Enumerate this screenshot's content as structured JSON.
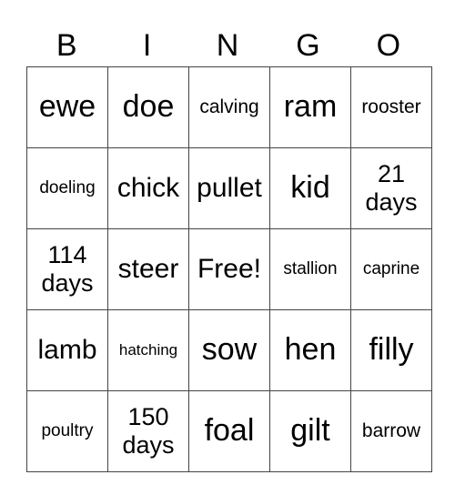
{
  "header": [
    "B",
    "I",
    "N",
    "G",
    "O"
  ],
  "cells": [
    [
      "ewe",
      "doe",
      "calving",
      "ram",
      "rooster"
    ],
    [
      "doeling",
      "chick",
      "pullet",
      "kid",
      "21 days"
    ],
    [
      "114 days",
      "steer",
      "Free!",
      "stallion",
      "caprine"
    ],
    [
      "lamb",
      "hatching",
      "sow",
      "hen",
      "filly"
    ],
    [
      "poultry",
      "150 days",
      "foal",
      "gilt",
      "barrow"
    ]
  ]
}
